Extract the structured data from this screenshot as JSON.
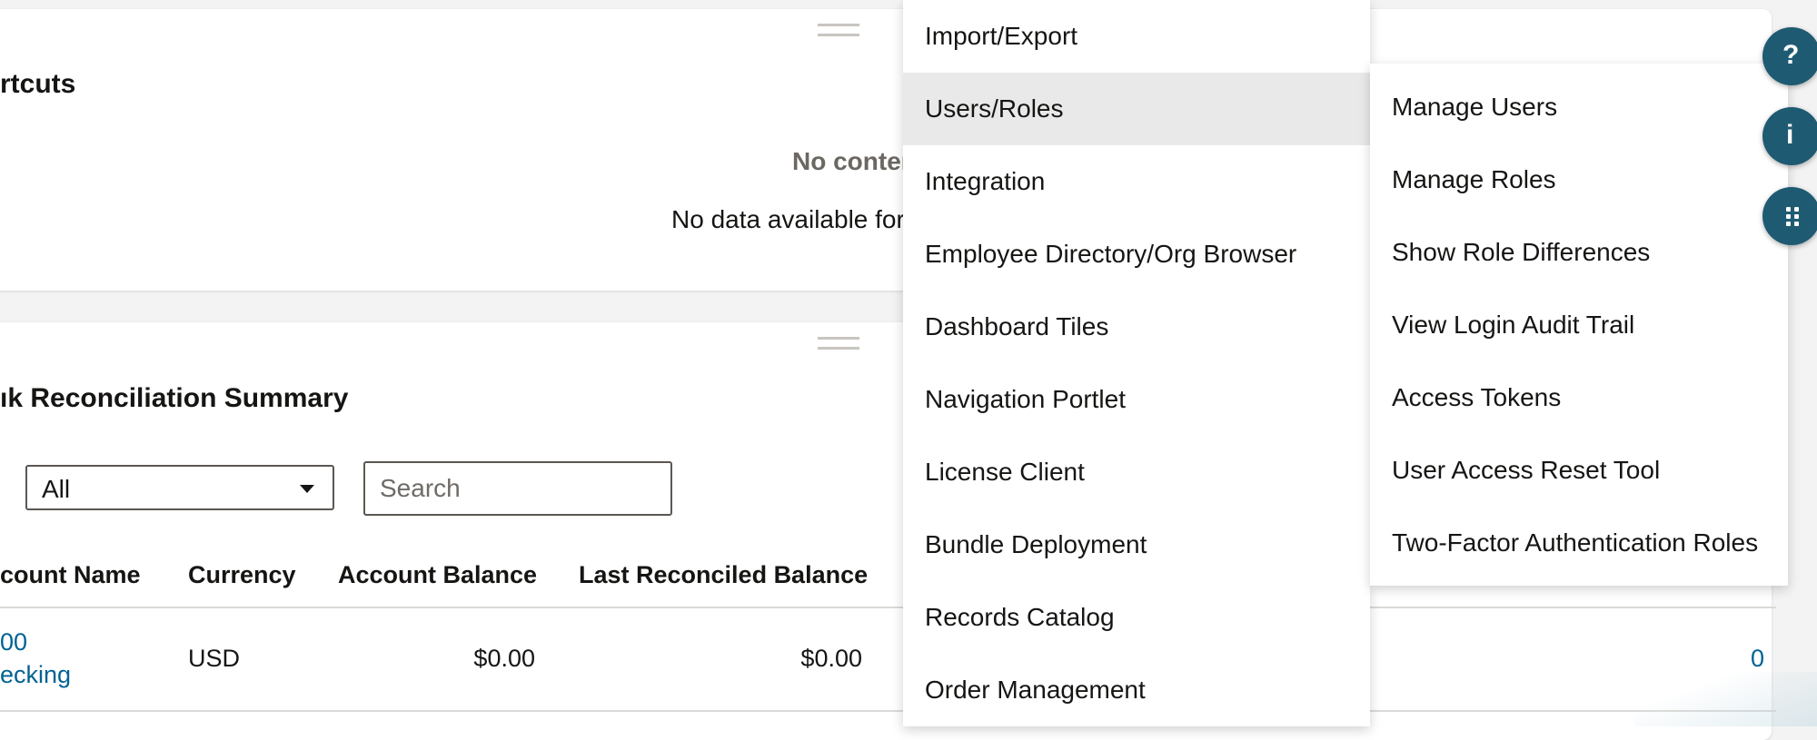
{
  "shortcuts_portlet": {
    "title": "rtcuts",
    "empty_title": "No content",
    "empty_message": "No data available for t"
  },
  "recon_portlet": {
    "title": "ık Reconciliation Summary",
    "filter": {
      "selected": "All"
    },
    "search": {
      "placeholder": "Search"
    },
    "columns": [
      "count Name",
      "Currency",
      "Account Balance",
      "Last Reconciled Balance"
    ],
    "rows": [
      {
        "account_line1": "00",
        "account_line2": "ecking",
        "currency": "USD",
        "account_balance": "$0.00",
        "last_reconciled_balance": "$0.00",
        "trailing_value": "0"
      }
    ]
  },
  "menu": {
    "items": [
      "Import/Export",
      "Users/Roles",
      "Integration",
      "Employee Directory/Org Browser",
      "Dashboard Tiles",
      "Navigation Portlet",
      "License Client",
      "Bundle Deployment",
      "Records Catalog",
      "Order Management"
    ],
    "active_index": 1
  },
  "submenu": {
    "items": [
      "Manage Users",
      "Manage Roles",
      "Show Role Differences",
      "View Login Audit Trail",
      "Access Tokens",
      "User Access Reset Tool",
      "Two-Factor Authentication Roles"
    ]
  },
  "side_buttons": {
    "help_label": "?",
    "info_label": "i"
  },
  "icons": {
    "help": "help-icon",
    "info": "info-icon",
    "grid": "grid-icon",
    "caret": "caret-down-icon"
  }
}
